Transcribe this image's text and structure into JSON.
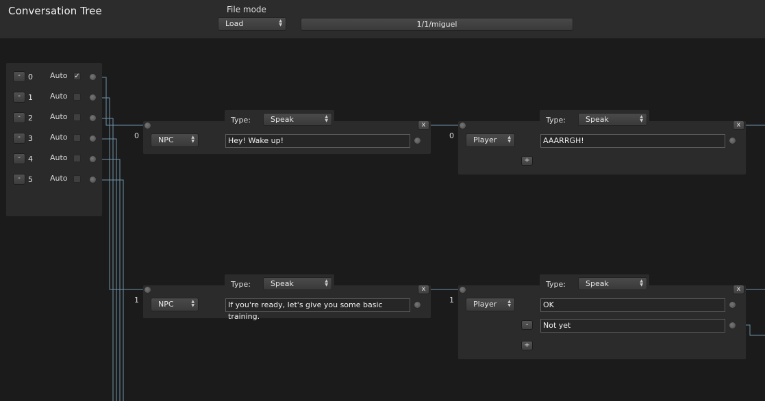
{
  "app": {
    "title": "Conversation Tree"
  },
  "file": {
    "mode_label": "File mode",
    "mode_value": "Load",
    "path": "1/1/miguel"
  },
  "entries": [
    {
      "remove_label": "-",
      "index": "0",
      "auto_label": "Auto",
      "auto_checked": true,
      "check_glyph": "✓"
    },
    {
      "remove_label": "-",
      "index": "1",
      "auto_label": "Auto",
      "auto_checked": false,
      "check_glyph": ""
    },
    {
      "remove_label": "-",
      "index": "2",
      "auto_label": "Auto",
      "auto_checked": false,
      "check_glyph": ""
    },
    {
      "remove_label": "-",
      "index": "3",
      "auto_label": "Auto",
      "auto_checked": false,
      "check_glyph": ""
    },
    {
      "remove_label": "-",
      "index": "4",
      "auto_label": "Auto",
      "auto_checked": false,
      "check_glyph": ""
    },
    {
      "remove_label": "-",
      "index": "5",
      "auto_label": "Auto",
      "auto_checked": false,
      "check_glyph": ""
    }
  ],
  "nodes": {
    "npc0": {
      "index": "0",
      "type_label": "Type:",
      "type_value": "Speak",
      "speaker": "NPC",
      "text": "Hey! Wake up!",
      "close_label": "x"
    },
    "player0": {
      "index": "0",
      "type_label": "Type:",
      "type_value": "Speak",
      "speaker": "Player",
      "responses": [
        "AAARRGH!"
      ],
      "add_label": "+",
      "close_label": "x"
    },
    "npc1": {
      "index": "1",
      "type_label": "Type:",
      "type_value": "Speak",
      "speaker": "NPC",
      "text_line1": "If you're ready, let's give you some basic",
      "text_line2": "training.",
      "close_label": "x"
    },
    "player1": {
      "index": "1",
      "type_label": "Type:",
      "type_value": "Speak",
      "speaker": "Player",
      "responses": [
        "OK",
        "Not yet"
      ],
      "remove_label": "-",
      "add_label": "+",
      "close_label": "x"
    }
  },
  "colors": {
    "wire": "#6f93a8",
    "background": "#1b1b1b",
    "panel": "#2b2b2b",
    "header": "#2c2c2c"
  },
  "icons": {
    "updown": "updown-arrows-icon",
    "port": "port-circle-icon",
    "check": "checkmark-icon"
  }
}
